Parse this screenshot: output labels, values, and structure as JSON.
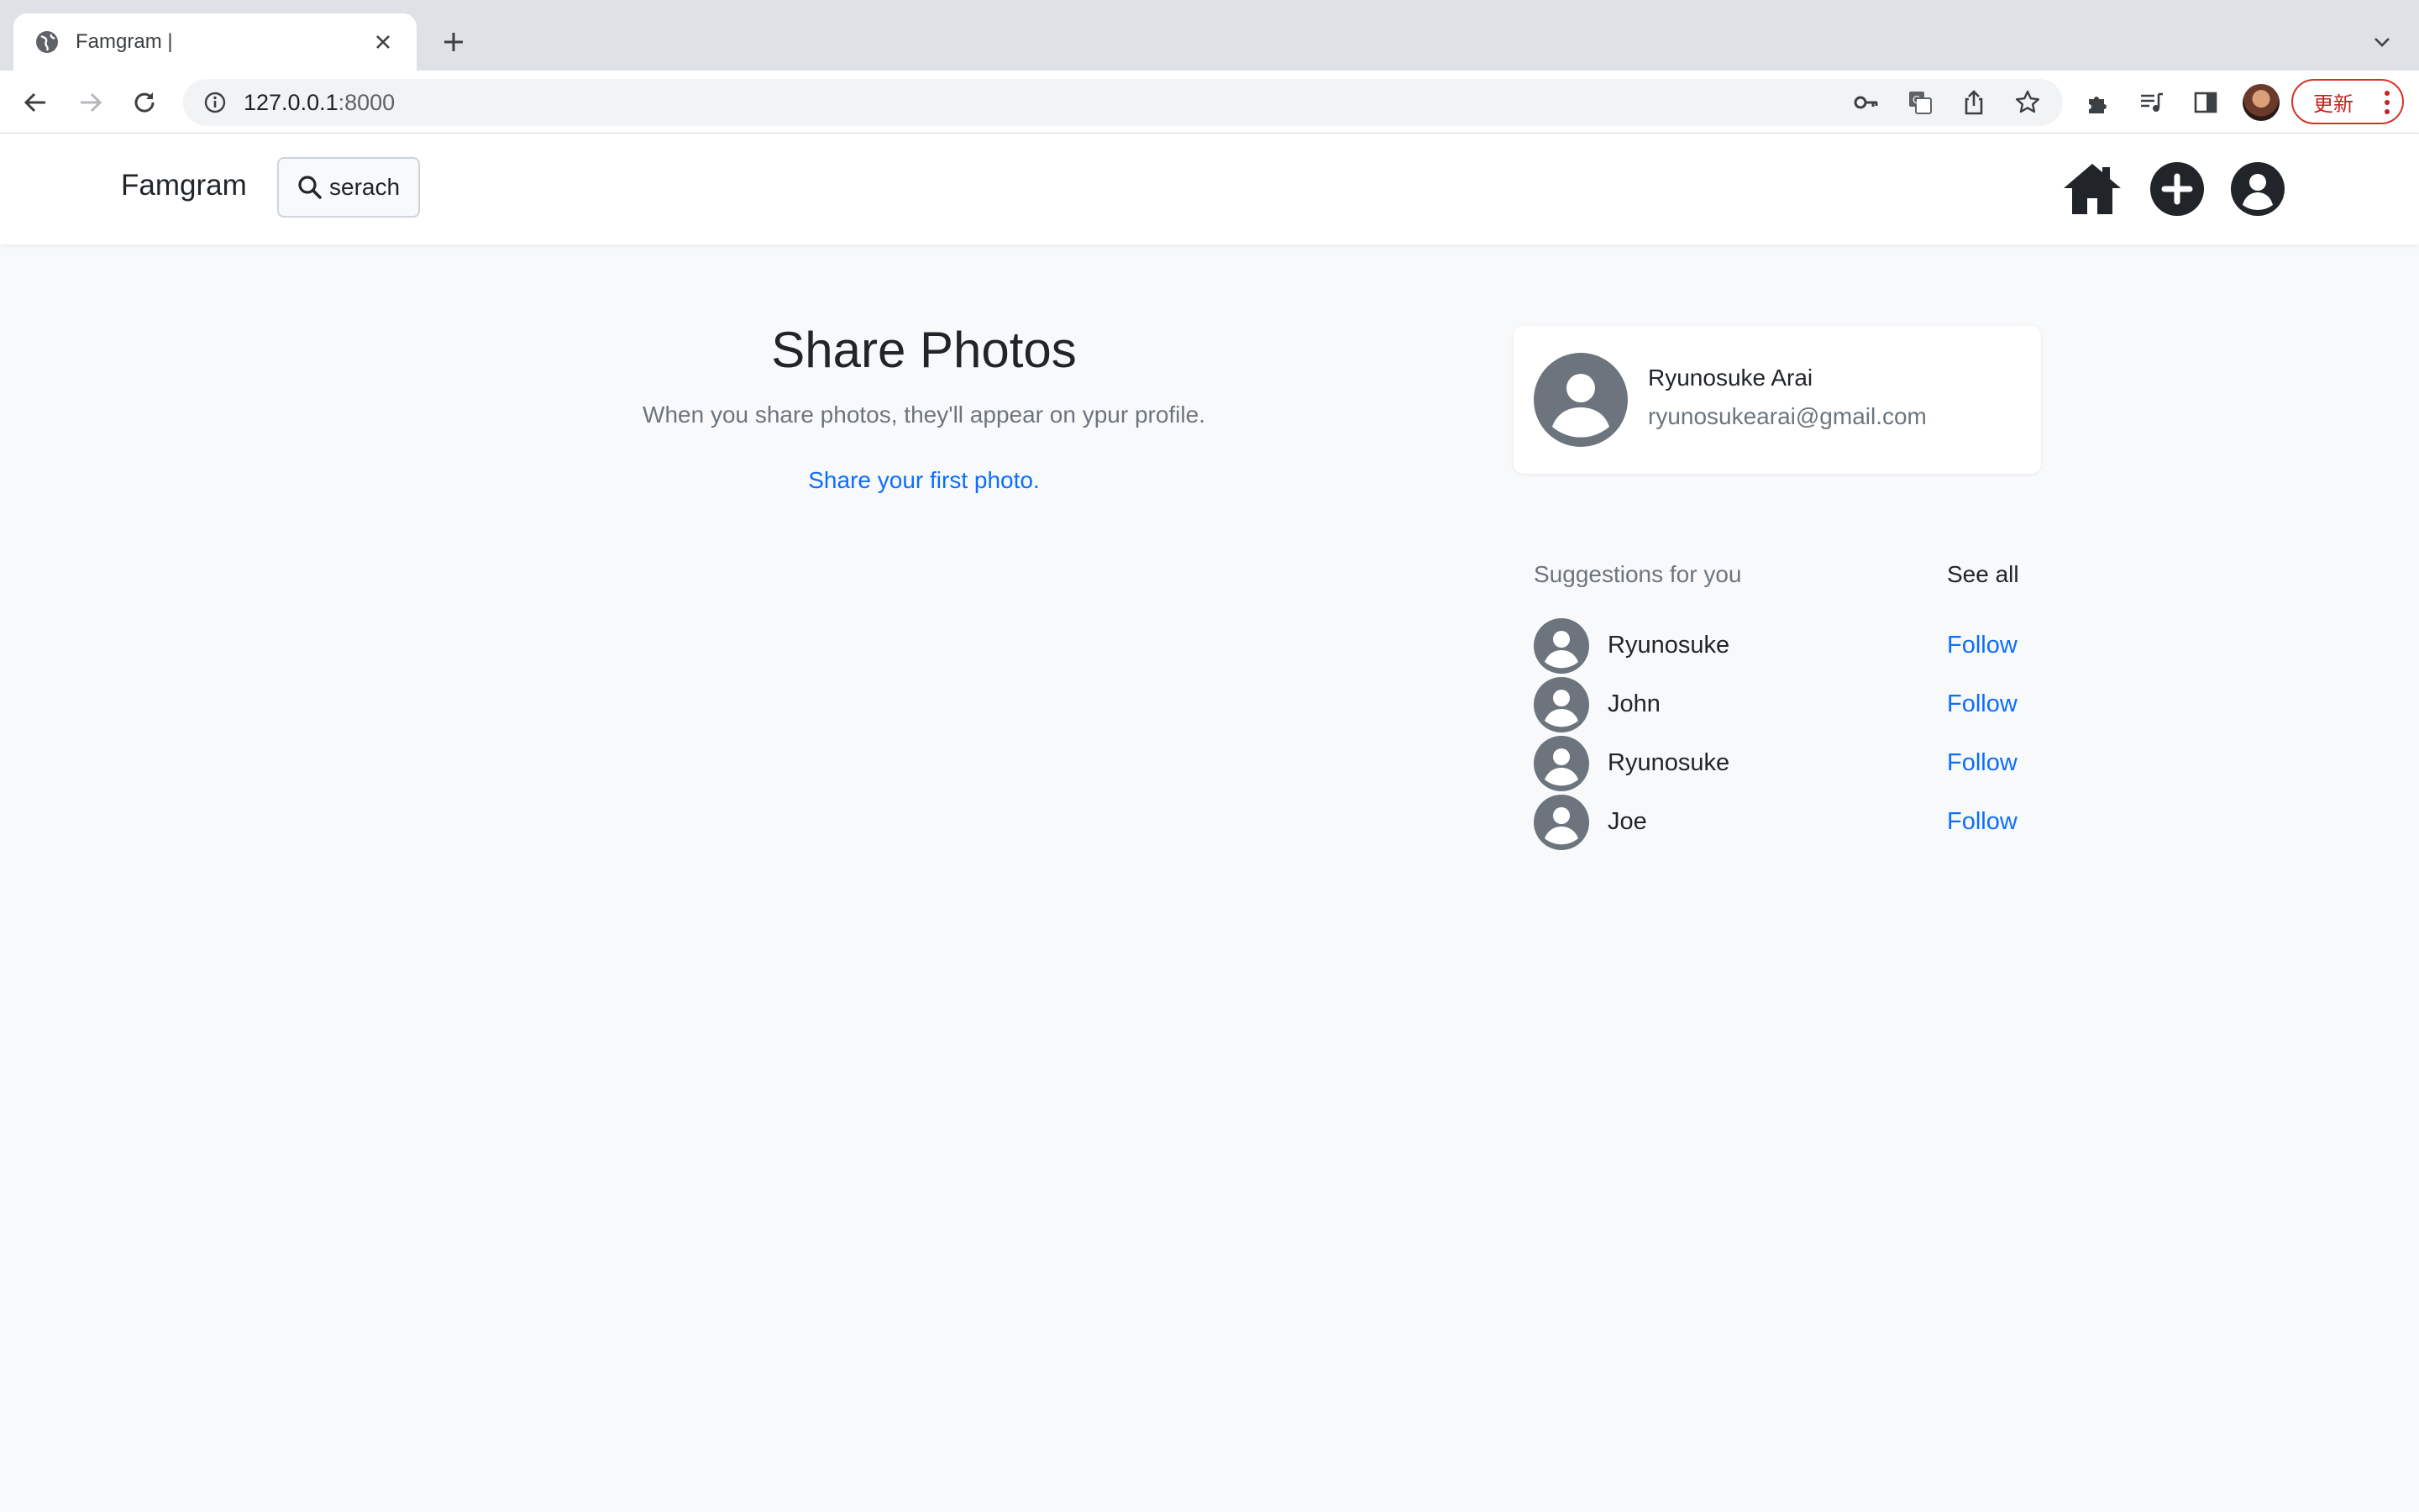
{
  "browser": {
    "tab_title": "Famgram |",
    "url_host": "127.0.0.1",
    "url_port": ":8000",
    "update_label": "更新"
  },
  "nav": {
    "brand": "Famgram",
    "search_label": "serach"
  },
  "main": {
    "title": "Share Photos",
    "subtitle": "When you share photos, they'll appear on ypur profile.",
    "cta": "Share your first photo."
  },
  "profile": {
    "name": "Ryunosuke Arai",
    "email": "ryunosukearai@gmail.com"
  },
  "suggestions": {
    "heading": "Suggestions for you",
    "see_all": "See all",
    "items": [
      {
        "name": "Ryunosuke",
        "action": "Follow"
      },
      {
        "name": "John",
        "action": "Follow"
      },
      {
        "name": "Ryunosuke",
        "action": "Follow"
      },
      {
        "name": "Joe",
        "action": "Follow"
      }
    ]
  },
  "colors": {
    "link": "#0d6efd",
    "muted": "#6c757d",
    "avatar_gray": "#6c757d",
    "update_red": "#d93025"
  },
  "icons": [
    "globe-icon",
    "close-icon",
    "plus-icon",
    "chevron-down-icon",
    "back-icon",
    "forward-icon",
    "reload-icon",
    "info-icon",
    "key-icon",
    "translate-icon",
    "share-icon",
    "star-icon",
    "puzzle-icon",
    "media-icon",
    "sidepanel-icon",
    "search-icon",
    "home-icon",
    "add-circle-icon",
    "account-icon",
    "person-avatar-icon"
  ]
}
